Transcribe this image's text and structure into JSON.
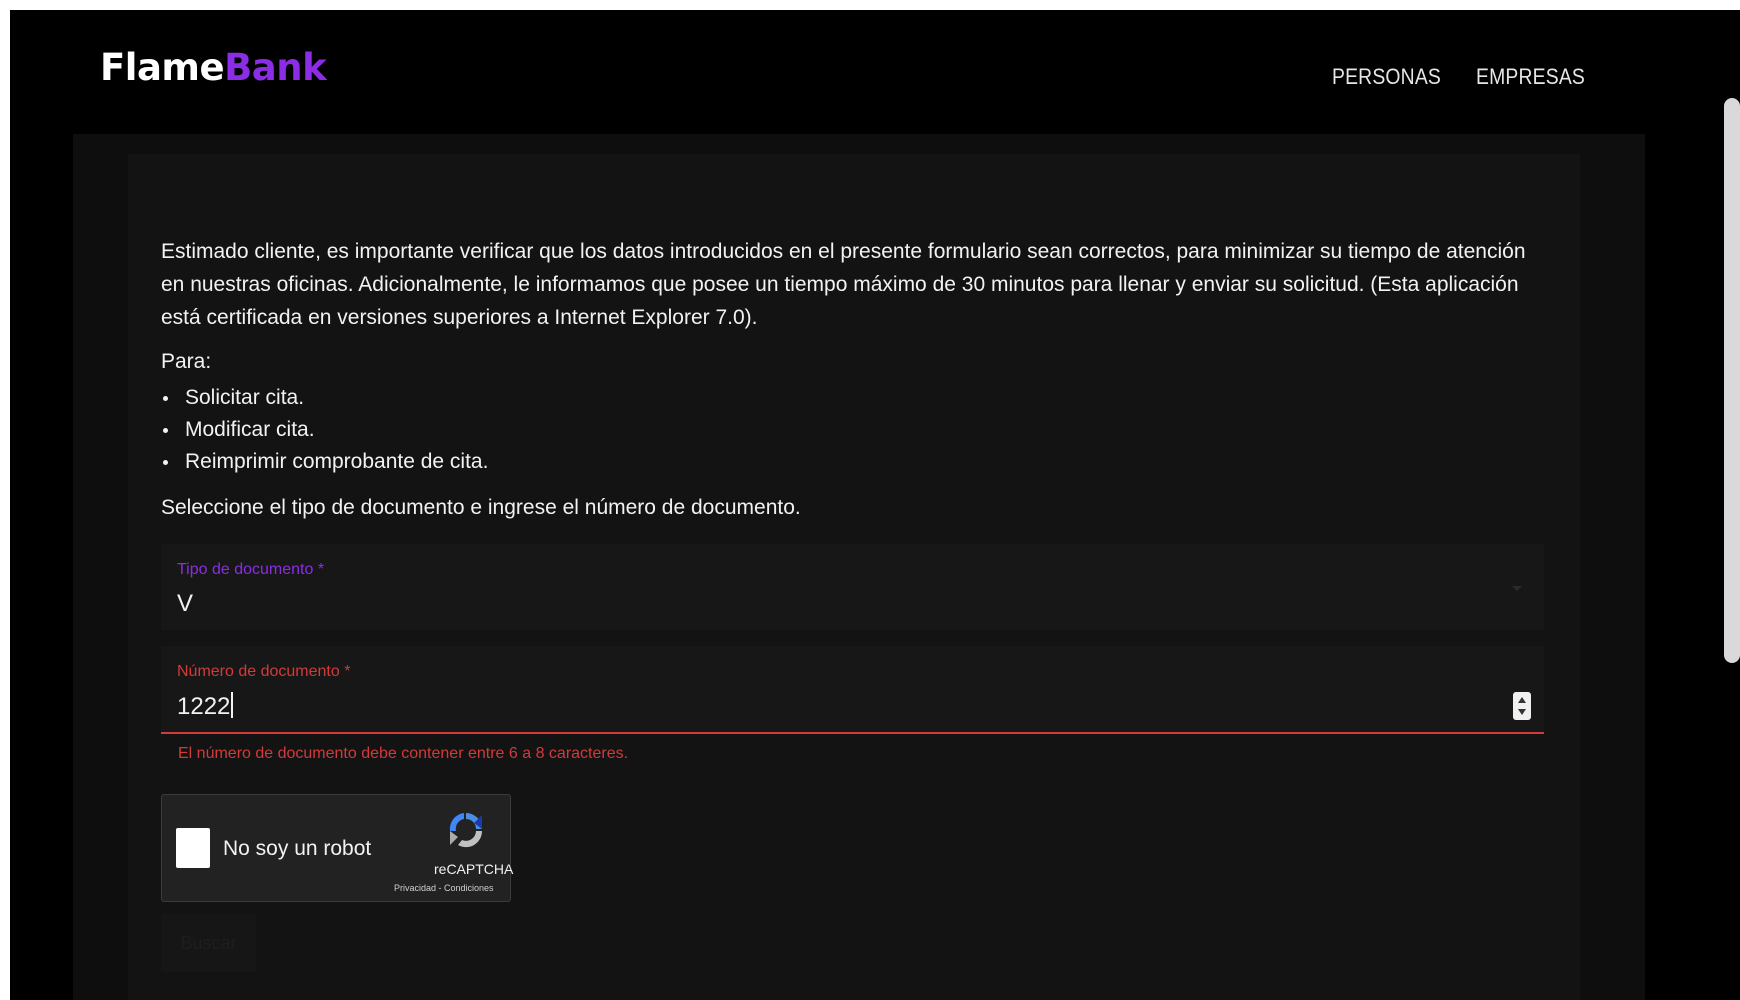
{
  "header": {
    "logo_primary": "Flame",
    "logo_secondary": "Bank",
    "nav": [
      "PERSONAS",
      "EMPRESAS"
    ]
  },
  "form": {
    "intro": "Estimado cliente, es importante verificar que los datos introducidos en el presente formulario sean correctos, para minimizar su tiempo de atención en nuestras oficinas. Adicionalmente, le informamos que posee un tiempo máximo de 30 minutos para llenar y enviar su solicitud. (Esta aplicación está certificada en versiones superiores a Internet Explorer 7.0).",
    "para_label": "Para:",
    "options": [
      "Solicitar cita.",
      "Modificar cita.",
      "Reimprimir comprobante de cita."
    ],
    "select_instruction": "Seleccione el tipo de documento e ingrese el número de documento.",
    "document_type": {
      "label": "Tipo de documento *",
      "value": "V"
    },
    "document_number": {
      "label": "Número de documento *",
      "value": "1222",
      "error": "El número de documento debe contener entre 6 a 8 caracteres."
    },
    "recaptcha": {
      "label": "No soy un robot",
      "brand": "reCAPTCHA",
      "terms": "Privacidad - Condiciones"
    },
    "submit_label": "Buscar"
  },
  "colors": {
    "accent": "#8b2ce6",
    "error": "#d33a3a",
    "background": "#000000",
    "panel": "#131313"
  }
}
